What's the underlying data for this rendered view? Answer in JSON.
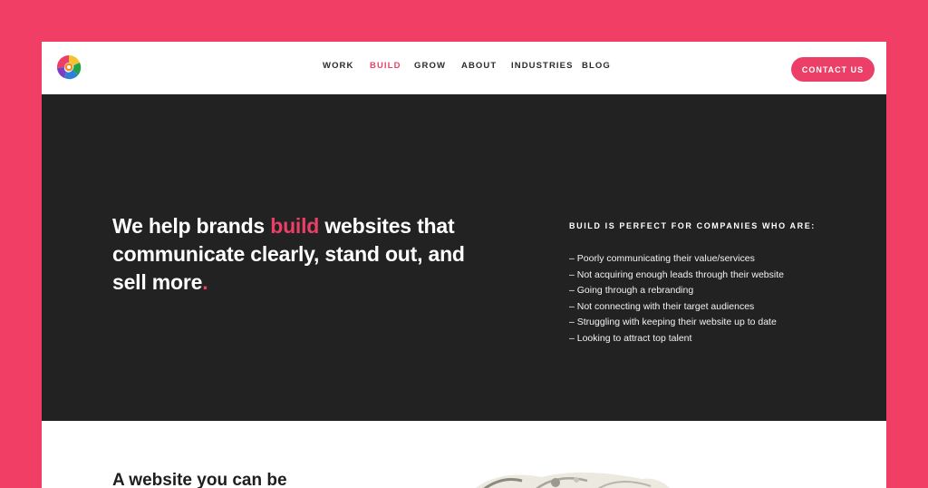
{
  "nav": {
    "items": [
      {
        "label": "WORK",
        "active": false
      },
      {
        "label": "BUILD",
        "active": true
      },
      {
        "label": "GROW",
        "active": false
      },
      {
        "label": "ABOUT",
        "active": false
      },
      {
        "label": "INDUSTRIES",
        "active": false
      },
      {
        "label": "BLOG",
        "active": false
      }
    ],
    "cta_label": "CONTACT US"
  },
  "hero": {
    "headline_before": "We help brands ",
    "headline_accent": "build",
    "headline_after": " websites that communicate clearly, stand out, and sell more",
    "headline_period": ".",
    "aside_title": "BUILD IS PERFECT FOR COMPANIES WHO ARE:",
    "aside_items": [
      "– Poorly communicating their value/services",
      "– Not acquiring enough leads through their website",
      "– Going through a rebranding",
      "– Not connecting with their target audiences",
      "– Struggling with keeping their website up to date",
      "– Looking to attract top talent"
    ]
  },
  "lower": {
    "title": "A website you can be"
  },
  "colors": {
    "background": "#f03e65",
    "accent": "#ec3f67",
    "hero_bg": "#222222",
    "text_dark": "#2b2b2b"
  },
  "icons": {
    "logo": "rainbow-shield-logo-icon"
  }
}
